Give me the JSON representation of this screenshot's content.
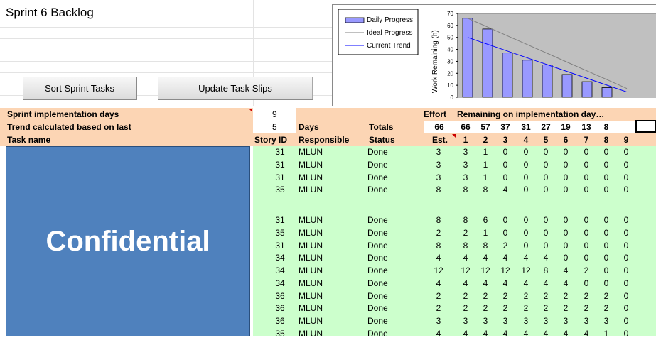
{
  "sheet": {
    "title": "Sprint 6 Backlog",
    "buttons": {
      "sort": "Sort Sprint Tasks",
      "update": "Update Task Slips"
    },
    "overlay_label": "Confidential"
  },
  "chart_data": {
    "type": "bar",
    "ylabel": "Work Remaining  (h)",
    "ylim": [
      0,
      70
    ],
    "yticks": [
      0,
      10,
      20,
      30,
      40,
      50,
      60,
      70
    ],
    "categories": [
      "1",
      "2",
      "3",
      "4",
      "5",
      "6",
      "7",
      "8",
      "9"
    ],
    "series": [
      {
        "name": "Daily Progress",
        "values": [
          66,
          57,
          37,
          31,
          27,
          19,
          13,
          8,
          null
        ]
      },
      {
        "name": "Ideal Progress",
        "values": [
          66,
          58.7,
          51.3,
          44,
          36.7,
          29.3,
          22,
          14.7,
          7.3
        ]
      },
      {
        "name": "Current Trend",
        "values": [
          50,
          44.3,
          38.6,
          32.9,
          27.2,
          21.5,
          15.8,
          10.1,
          4.4
        ]
      }
    ],
    "legend": [
      "Daily Progress",
      "Ideal Progress",
      "Current Trend"
    ],
    "colors": {
      "bar": "#9999ff",
      "ideal": "#808080",
      "trend": "#0000ff",
      "plot_bg": "#c0c0c0"
    }
  },
  "header": {
    "impl_days_label": "Sprint implementation days",
    "impl_days_value": "9",
    "trend_label": "Trend calculated based on last",
    "trend_value": "5",
    "days_label": "Days",
    "totals_label": "Totals",
    "effort_label": "Effort",
    "remaining_label": "Remaining on implementation day…",
    "totals_est": "66",
    "totals": [
      "66",
      "57",
      "37",
      "31",
      "27",
      "19",
      "13",
      "8",
      ""
    ],
    "col_task": "Task name",
    "col_story": "Story ID",
    "col_resp": "Responsible",
    "col_status": "Status",
    "col_est": "Est.",
    "days": [
      "1",
      "2",
      "3",
      "4",
      "5",
      "6",
      "7",
      "8",
      "9"
    ]
  },
  "rows": [
    {
      "story": "31",
      "resp": "MLUN",
      "status": "Done",
      "est": "3",
      "d": [
        "3",
        "1",
        "0",
        "0",
        "0",
        "0",
        "0",
        "0",
        "0"
      ]
    },
    {
      "story": "31",
      "resp": "MLUN",
      "status": "Done",
      "est": "3",
      "d": [
        "3",
        "1",
        "0",
        "0",
        "0",
        "0",
        "0",
        "0",
        "0"
      ]
    },
    {
      "story": "31",
      "resp": "MLUN",
      "status": "Done",
      "est": "3",
      "d": [
        "3",
        "1",
        "0",
        "0",
        "0",
        "0",
        "0",
        "0",
        "0"
      ]
    },
    {
      "story": "35",
      "resp": "MLUN",
      "status": "Done",
      "est": "8",
      "d": [
        "8",
        "8",
        "4",
        "0",
        "0",
        "0",
        "0",
        "0",
        "0"
      ]
    },
    {
      "story": "",
      "resp": "",
      "status": "",
      "est": "",
      "d": [
        "",
        "",
        "",
        "",
        "",
        "",
        "",
        "",
        ""
      ]
    },
    {
      "story": "31",
      "resp": "MLUN",
      "status": "Done",
      "est": "8",
      "d": [
        "8",
        "6",
        "0",
        "0",
        "0",
        "0",
        "0",
        "0",
        "0"
      ]
    },
    {
      "story": "35",
      "resp": "MLUN",
      "status": "Done",
      "est": "2",
      "d": [
        "2",
        "1",
        "0",
        "0",
        "0",
        "0",
        "0",
        "0",
        "0"
      ]
    },
    {
      "story": "31",
      "resp": "MLUN",
      "status": "Done",
      "est": "8",
      "d": [
        "8",
        "8",
        "2",
        "0",
        "0",
        "0",
        "0",
        "0",
        "0"
      ]
    },
    {
      "story": "34",
      "resp": "MLUN",
      "status": "Done",
      "est": "4",
      "d": [
        "4",
        "4",
        "4",
        "4",
        "4",
        "0",
        "0",
        "0",
        "0"
      ]
    },
    {
      "story": "34",
      "resp": "MLUN",
      "status": "Done",
      "est": "12",
      "d": [
        "12",
        "12",
        "12",
        "12",
        "8",
        "4",
        "2",
        "0",
        "0"
      ]
    },
    {
      "story": "34",
      "resp": "MLUN",
      "status": "Done",
      "est": "4",
      "d": [
        "4",
        "4",
        "4",
        "4",
        "4",
        "4",
        "0",
        "0",
        "0"
      ]
    },
    {
      "story": "36",
      "resp": "MLUN",
      "status": "Done",
      "est": "2",
      "d": [
        "2",
        "2",
        "2",
        "2",
        "2",
        "2",
        "2",
        "2",
        "0"
      ]
    },
    {
      "story": "36",
      "resp": "MLUN",
      "status": "Done",
      "est": "2",
      "d": [
        "2",
        "2",
        "2",
        "2",
        "2",
        "2",
        "2",
        "2",
        "0"
      ]
    },
    {
      "story": "36",
      "resp": "MLUN",
      "status": "Done",
      "est": "3",
      "d": [
        "3",
        "3",
        "3",
        "3",
        "3",
        "3",
        "3",
        "3",
        "0"
      ]
    },
    {
      "story": "35",
      "resp": "MLUN",
      "status": "Done",
      "est": "4",
      "d": [
        "4",
        "4",
        "4",
        "4",
        "4",
        "4",
        "4",
        "1",
        "0"
      ]
    }
  ]
}
